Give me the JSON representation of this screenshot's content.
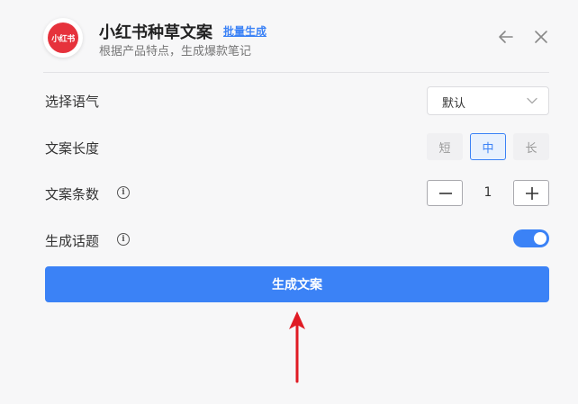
{
  "colors": {
    "accent": "#3b82f6",
    "logo_red": "#e6323c",
    "arrow_red": "#e01b24"
  },
  "header": {
    "logo_text": "小红书",
    "title": "小红书种草文案",
    "batch_link": "批量生成",
    "subtitle": "根据产品特点，生成爆款笔记",
    "icons": {
      "back": "arrow-left-icon",
      "close": "close-icon"
    }
  },
  "settings": {
    "tone": {
      "label": "选择语气",
      "value": "默认",
      "icon": "chevron-down-icon"
    },
    "length": {
      "label": "文案长度",
      "options": [
        "短",
        "中",
        "长"
      ],
      "selected": "中"
    },
    "count": {
      "label": "文案条数",
      "info_icon": "info-icon",
      "value": "1",
      "minus_icon": "minus-icon",
      "plus_icon": "plus-icon"
    },
    "topic": {
      "label": "生成话题",
      "info_icon": "info-icon",
      "enabled": true
    }
  },
  "generate_button": "生成文案",
  "annotation": {
    "icon": "red-arrow-up-icon"
  }
}
